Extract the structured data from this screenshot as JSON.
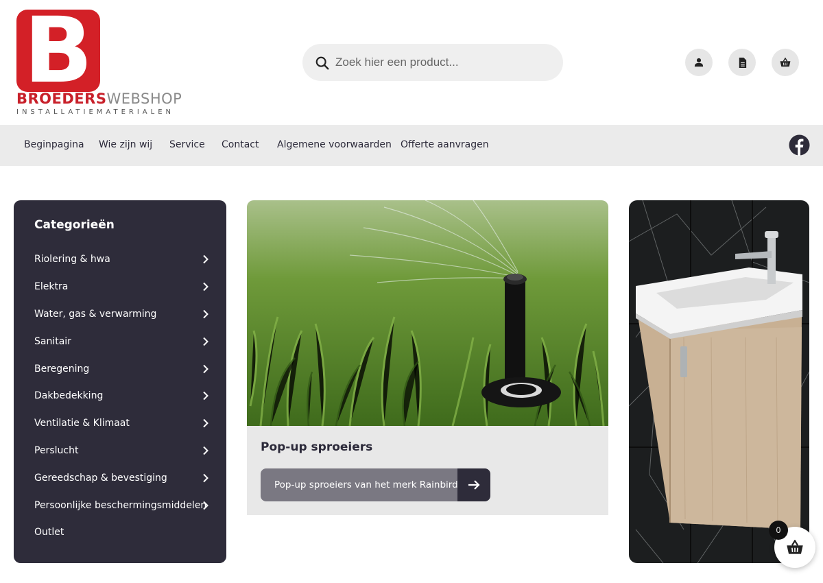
{
  "logo": {
    "name_part1": "BROEDERS",
    "name_part2": "WEBSHOP",
    "subtitle": "INSTALLATIEMATERIALEN",
    "letter": "B",
    "brand_color": "#d32027"
  },
  "search": {
    "placeholder": "Zoek hier een product...",
    "value": ""
  },
  "header_icons": [
    "account-icon",
    "document-icon",
    "basket-icon"
  ],
  "nav": {
    "items": [
      "Beginpagina",
      "Wie zijn wij",
      "Service",
      "Contact",
      "Algemene voorwaarden",
      "Offerte aanvragen"
    ],
    "social": "facebook-icon"
  },
  "sidebar": {
    "title": "Categorieën",
    "items": [
      {
        "label": "Riolering & hwa",
        "has_children": true
      },
      {
        "label": "Elektra",
        "has_children": true
      },
      {
        "label": "Water, gas & verwarming",
        "has_children": true
      },
      {
        "label": "Sanitair",
        "has_children": true
      },
      {
        "label": "Beregening",
        "has_children": true
      },
      {
        "label": "Dakbedekking",
        "has_children": true
      },
      {
        "label": "Ventilatie & Klimaat",
        "has_children": true
      },
      {
        "label": "Perslucht",
        "has_children": true
      },
      {
        "label": "Gereedschap & bevestiging",
        "has_children": true
      },
      {
        "label": "Persoonlijke beschermingsmiddelen",
        "has_children": true
      },
      {
        "label": "Outlet",
        "has_children": false
      }
    ],
    "background": "#2e2c3a"
  },
  "promo": {
    "title": "Pop-up sproeiers",
    "button_label": "Pop-up sproeiers van het merk Rainbird",
    "image": "sprinkler-in-grass-image"
  },
  "side_image": "washbasin-cabinet-image",
  "cart": {
    "count": "0"
  }
}
